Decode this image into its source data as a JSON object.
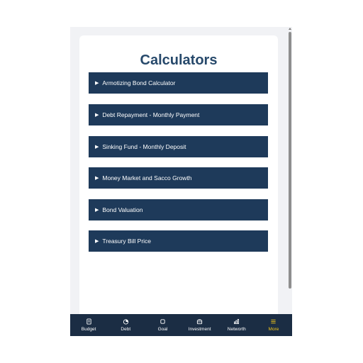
{
  "page": {
    "title": "Calculators"
  },
  "calculators": [
    {
      "label": "Armotizing Bond Calculator"
    },
    {
      "label": "Debt Repayment - Monthly Payment"
    },
    {
      "label": "Sinking Fund - Monthly Deposit"
    },
    {
      "label": "Money Market and Sacco Growth"
    },
    {
      "label": "Bond Valuation"
    },
    {
      "label": "Treasury Bill Price"
    }
  ],
  "expand_glyph": "▶",
  "nav": {
    "items": [
      {
        "label": "Budget",
        "icon": "budget-icon"
      },
      {
        "label": "Debt",
        "icon": "debt-icon"
      },
      {
        "label": "Goal",
        "icon": "goal-icon"
      },
      {
        "label": "Investment",
        "icon": "investment-icon"
      },
      {
        "label": "Networth",
        "icon": "networth-icon"
      },
      {
        "label": "More",
        "icon": "menu-icon"
      }
    ],
    "active": "More"
  },
  "colors": {
    "accent": "#27496b",
    "item_bg": "#1e3a5a",
    "nav_bg": "#1b2d44",
    "active": "#f0c419"
  }
}
